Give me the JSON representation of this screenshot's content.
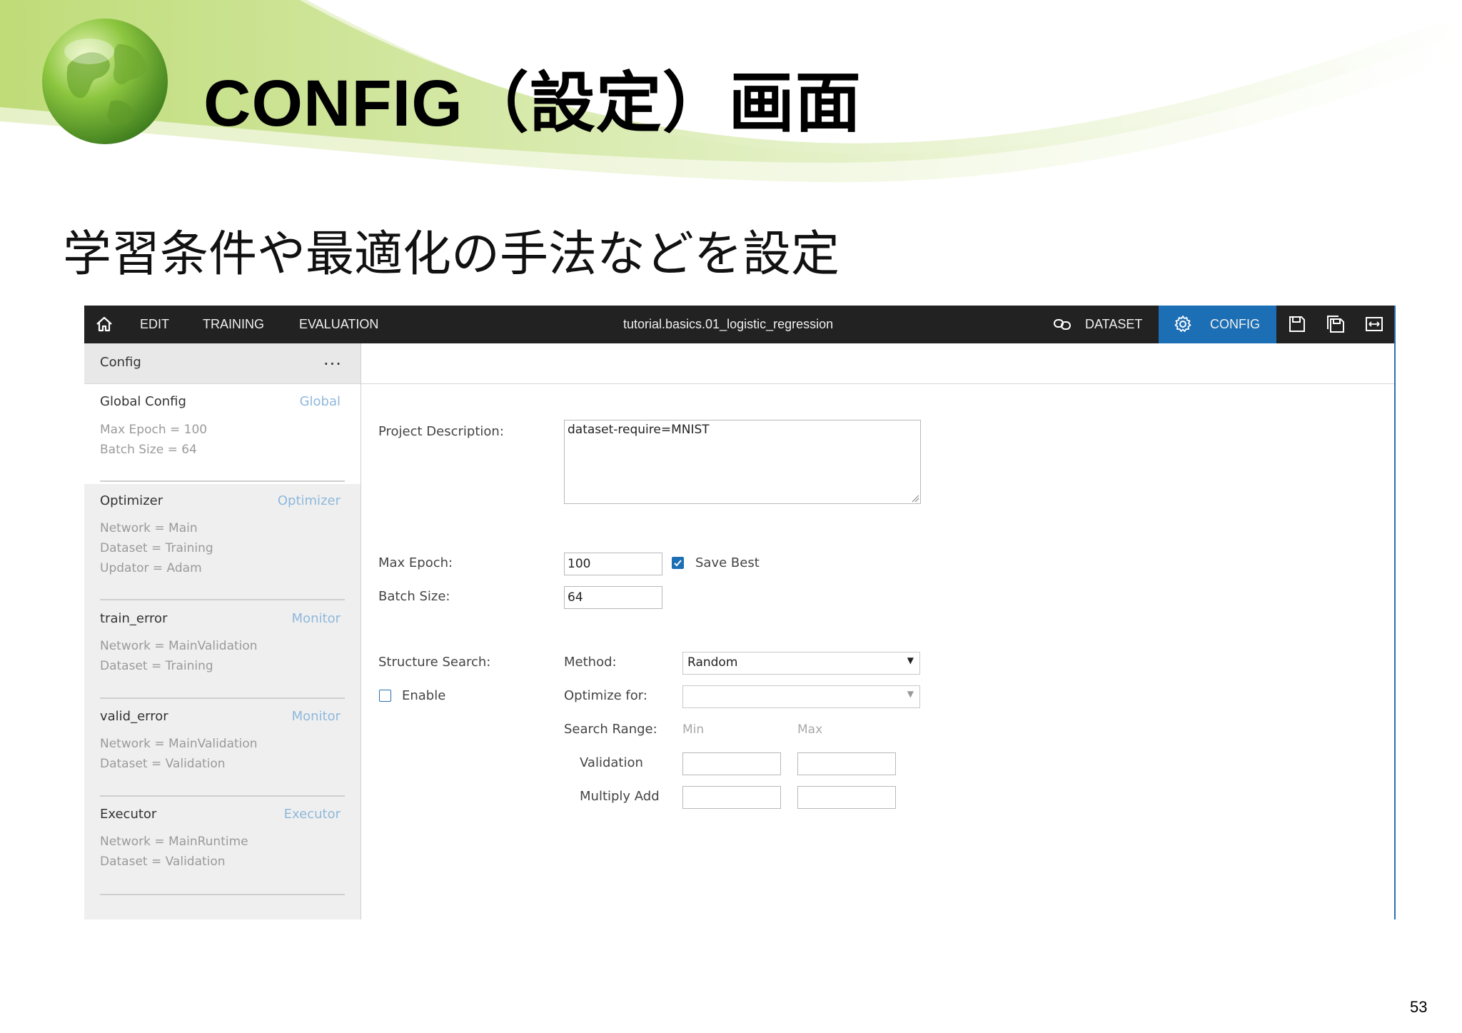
{
  "slide": {
    "title": "CONFIG（設定）画面",
    "subtitle": "学習条件や最適化の手法などを設定",
    "page_number": "53"
  },
  "app": {
    "nav": {
      "edit": "EDIT",
      "training": "TRAINING",
      "evaluation": "EVALUATION"
    },
    "project_title": "tutorial.basics.01_logistic_regression",
    "right_tabs": {
      "dataset": "DATASET",
      "config": "CONFIG"
    },
    "colors": {
      "topbar": "#222222",
      "active_tab": "#1c6fb4",
      "type_label": "#8fb8dc"
    },
    "left_panel": {
      "header": "Config",
      "more": "...",
      "cards": [
        {
          "title": "Global Config",
          "type": "Global",
          "lines": [
            "Max Epoch = 100",
            "Batch Size = 64"
          ],
          "selected": true
        },
        {
          "title": "Optimizer",
          "type": "Optimizer",
          "lines": [
            "Network = Main",
            "Dataset = Training",
            "Updator = Adam"
          ]
        },
        {
          "title": "train_error",
          "type": "Monitor",
          "lines": [
            "Network = MainValidation",
            "Dataset = Training"
          ]
        },
        {
          "title": "valid_error",
          "type": "Monitor",
          "lines": [
            "Network = MainValidation",
            "Dataset = Validation"
          ]
        },
        {
          "title": "Executor",
          "type": "Executor",
          "lines": [
            "Network = MainRuntime",
            "Dataset = Validation"
          ]
        }
      ]
    },
    "form": {
      "project_description_label": "Project Description:",
      "project_description_value": "dataset-require=MNIST",
      "max_epoch_label": "Max Epoch:",
      "max_epoch_value": "100",
      "save_best_label": "Save Best",
      "save_best_checked": true,
      "batch_size_label": "Batch Size:",
      "batch_size_value": "64",
      "structure_search_label": "Structure Search:",
      "enable_label": "Enable",
      "enable_checked": false,
      "method_label": "Method:",
      "method_value": "Random",
      "optimize_for_label": "Optimize for:",
      "optimize_for_value": "",
      "search_range_label": "Search Range:",
      "min_label": "Min",
      "max_label": "Max",
      "validation_label": "Validation",
      "multiply_add_label": "Multiply Add",
      "validation_min": "",
      "validation_max": "",
      "multiply_add_min": "",
      "multiply_add_max": ""
    }
  }
}
